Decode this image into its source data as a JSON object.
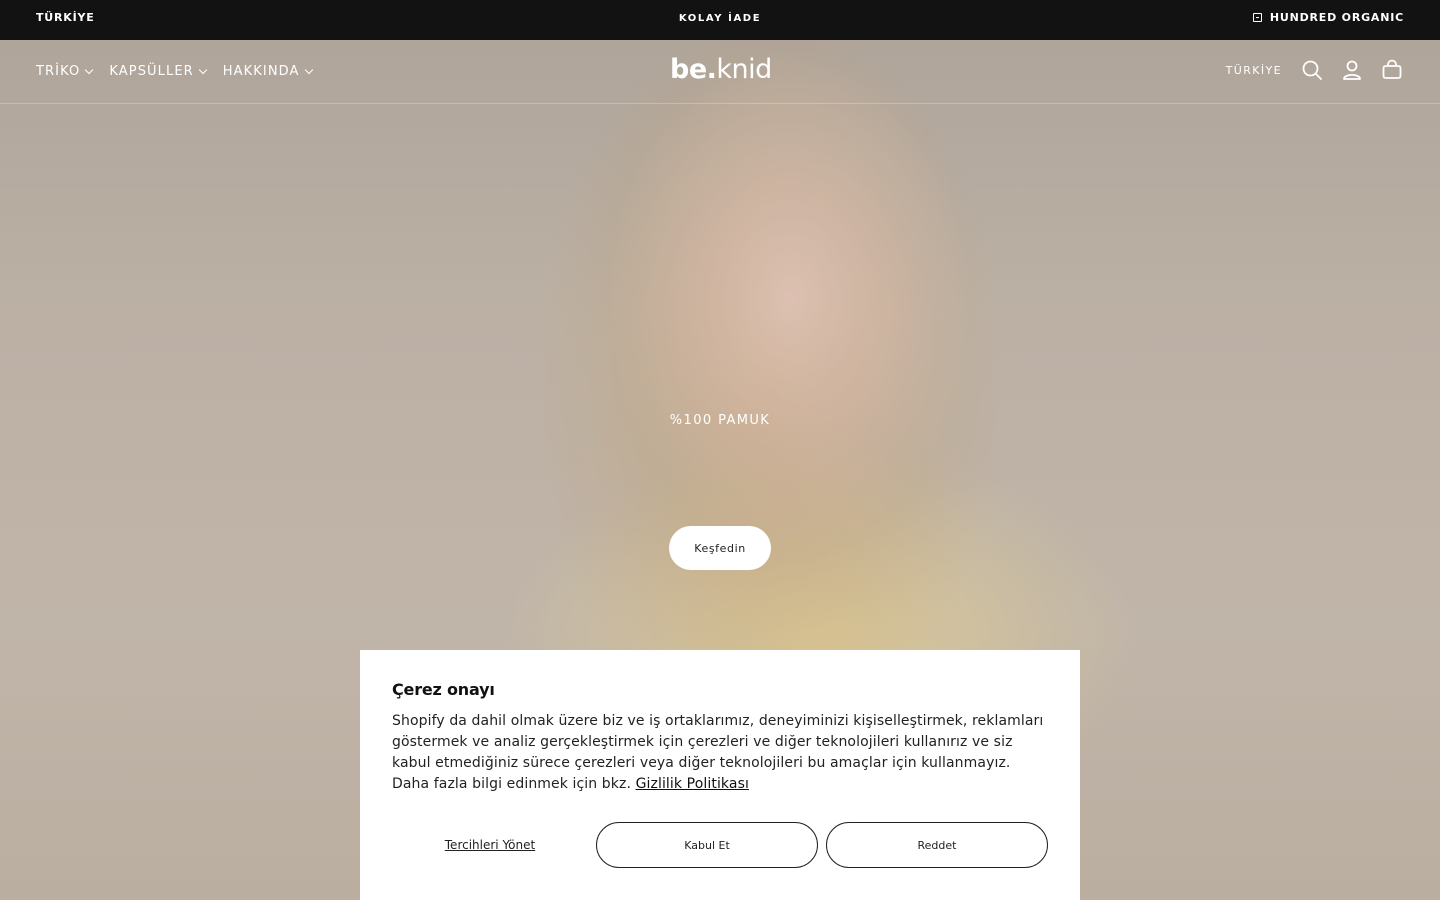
{
  "announcement": {
    "left": "TÜRKİYE",
    "center": "KOLAY İADE",
    "right": "HUNDRED ORGANIC"
  },
  "header": {
    "nav": [
      {
        "label": "TRİKO"
      },
      {
        "label": "KAPSÜLLER"
      },
      {
        "label": "HAKKINDA"
      }
    ],
    "logo_bold": "be.",
    "logo_light": "knid",
    "country": "TÜRKİYE",
    "icons": [
      "search-icon",
      "account-icon",
      "cart-icon"
    ]
  },
  "hero": {
    "subtitle": "%100 PAMUK",
    "cta_label": "Keşfedin"
  },
  "cookie": {
    "title": "Çerez onayı",
    "body": "Shopify da dahil olmak üzere biz ve iş ortaklarımız, deneyiminizi kişiselleştirmek, reklamları göstermek ve analiz gerçekleştirmek için çerezleri ve diğer teknolojileri kullanırız ve siz kabul etmediğiniz sürece çerezleri veya diğer teknolojileri bu amaçlar için kullanmayız. Daha fazla bilgi edinmek için bkz.",
    "policy_link": "Gizlilik Politikası",
    "manage_label": "Tercihleri Yönet",
    "accept_label": "Kabul Et",
    "reject_label": "Reddet"
  }
}
